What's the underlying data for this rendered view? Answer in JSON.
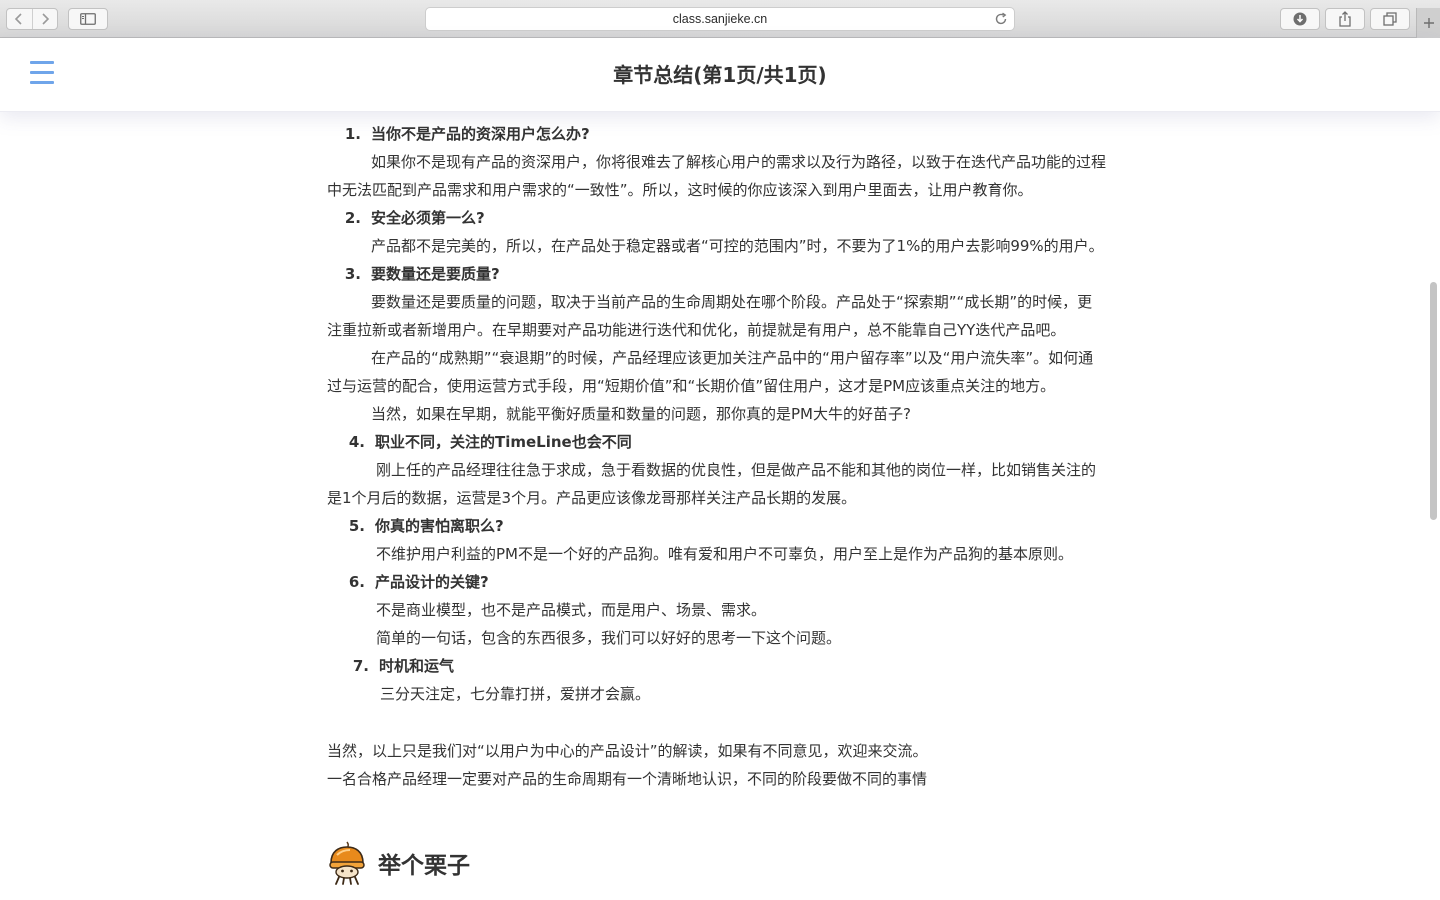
{
  "browser": {
    "url_host": "class.sanjieke.cn"
  },
  "header": {
    "title": "章节总结(第1页/共1页)"
  },
  "sections": [
    {
      "num": "1.",
      "title": "当你不是产品的资深用户怎么办?",
      "paragraphs": [
        "如果你不是现有产品的资深用户，你将很难去了解核心用户的需求以及行为路径，以致于在迭代产品功能的过程中无法匹配到产品需求和用户需求的“一致性”。所以，这时候的你应该深入到用户里面去，让用户教育你。"
      ]
    },
    {
      "num": "2.",
      "title": "安全必须第一么?",
      "paragraphs": [
        "产品都不是完美的，所以，在产品处于稳定器或者“可控的范围内”时，不要为了1%的用户去影响99%的用户。"
      ]
    },
    {
      "num": "3.",
      "title": "要数量还是要质量?",
      "paragraphs": [
        "要数量还是要质量的问题，取决于当前产品的生命周期处在哪个阶段。产品处于“探索期”“成长期”的时候，更注重拉新或者新增用户。在早期要对产品功能进行迭代和优化，前提就是有用户，总不能靠自己YY迭代产品吧。",
        "在产品的“成熟期”“衰退期”的时候，产品经理应该更加关注产品中的“用户留存率”以及“用户流失率”。如何通过与运营的配合，使用运营方式手段，用“短期价值”和“长期价值”留住用户，这才是PM应该重点关注的地方。",
        "当然，如果在早期，就能平衡好质量和数量的问题，那你真的是PM大牛的好苗子?"
      ]
    },
    {
      "num": "4.",
      "title": "职业不同，关注的TimeLine也会不同",
      "paragraphs": [
        "刚上任的产品经理往往急于求成，急于看数据的优良性，但是做产品不能和其他的岗位一样，比如销售关注的是1个月后的数据，运营是3个月。产品更应该像龙哥那样关注产品长期的发展。"
      ]
    },
    {
      "num": "5.",
      "title": "你真的害怕离职么?",
      "paragraphs": [
        "不维护用户利益的PM不是一个好的产品狗。唯有爱和用户不可辜负，用户至上是作为产品狗的基本原则。"
      ]
    },
    {
      "num": "6.",
      "title": "产品设计的关键?",
      "paragraphs": [
        "不是商业模型，也不是产品模式，而是用户、场景、需求。",
        "简单的一句话，包含的东西很多，我们可以好好的思考一下这个问题。"
      ]
    },
    {
      "num": "7.",
      "title": "时机和运气",
      "paragraphs": [
        "三分天注定，七分靠打拼，爱拼才会赢。"
      ]
    }
  ],
  "closing": [
    "当然，以上只是我们对“以用户为中心的产品设计”的解读，如果有不同意见，欢迎来交流。",
    "一名合格产品经理一定要对产品的生命周期有一个清晰地认识，不同的阶段要做不同的事情"
  ],
  "example": {
    "heading": "举个栗子",
    "icon": "chestnut-mascot-icon"
  },
  "colors": {
    "accent": "#6fa5ea",
    "text": "#333333"
  }
}
